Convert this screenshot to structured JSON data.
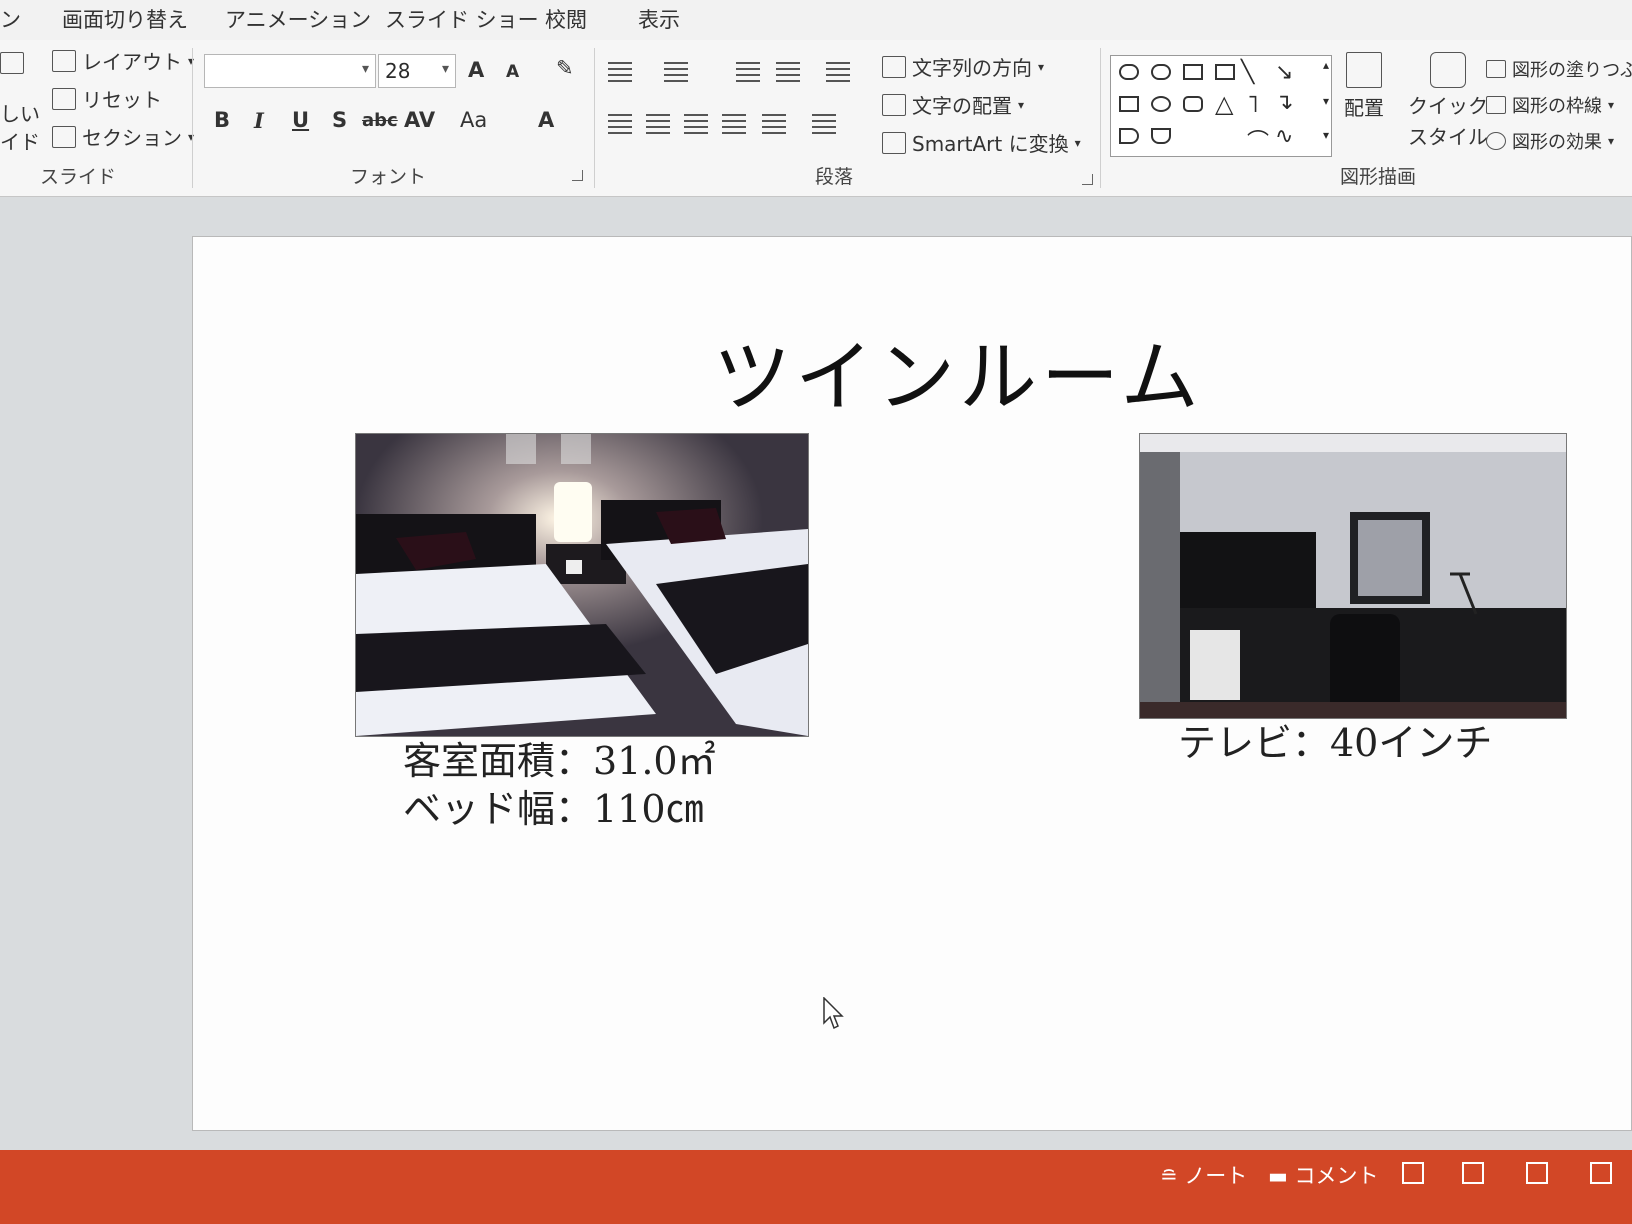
{
  "tabs": {
    "partial": "ン",
    "transitions": "画面切り替え",
    "animations": "アニメーション",
    "slideshow": "スライド ショー",
    "review": "校閲",
    "view": "表示"
  },
  "ribbon": {
    "slides_group": {
      "layout": "レイアウト",
      "reset": "リセット",
      "section": "セクション",
      "partial_new_a": "しい",
      "partial_new_b": "イド",
      "label": "スライド"
    },
    "font_group": {
      "font_name_value": "",
      "font_size_value": "28",
      "grow": "A",
      "shrink": "A",
      "bold": "B",
      "italic": "I",
      "underline": "U",
      "shadow": "S",
      "strike": "abc",
      "spacing": "AV",
      "case": "Aa",
      "color": "A",
      "label": "フォント"
    },
    "paragraph_group": {
      "text_direction": "文字列の方向",
      "align_text": "文字の配置",
      "smartart": "SmartArt に変換",
      "label": "段落"
    },
    "drawing_group": {
      "arrange": "配置",
      "quick_styles_a": "クイック",
      "quick_styles_b": "スタイル",
      "shape_fill": "図形の塗りつぶ",
      "shape_outline": "図形の枠線",
      "shape_effects": "図形の効果",
      "label": "図形描画"
    }
  },
  "slide": {
    "title": "ツインルーム",
    "caption_left_line1": "客室面積：31.0㎡",
    "caption_left_line2": "ベッド幅：110㎝",
    "caption_right": "テレビ：40インチ"
  },
  "statusbar": {
    "notes": "ノート",
    "comments": "コメント"
  },
  "colors": {
    "statusbar": "#d24726",
    "ribbon": "#f6f6f6"
  }
}
